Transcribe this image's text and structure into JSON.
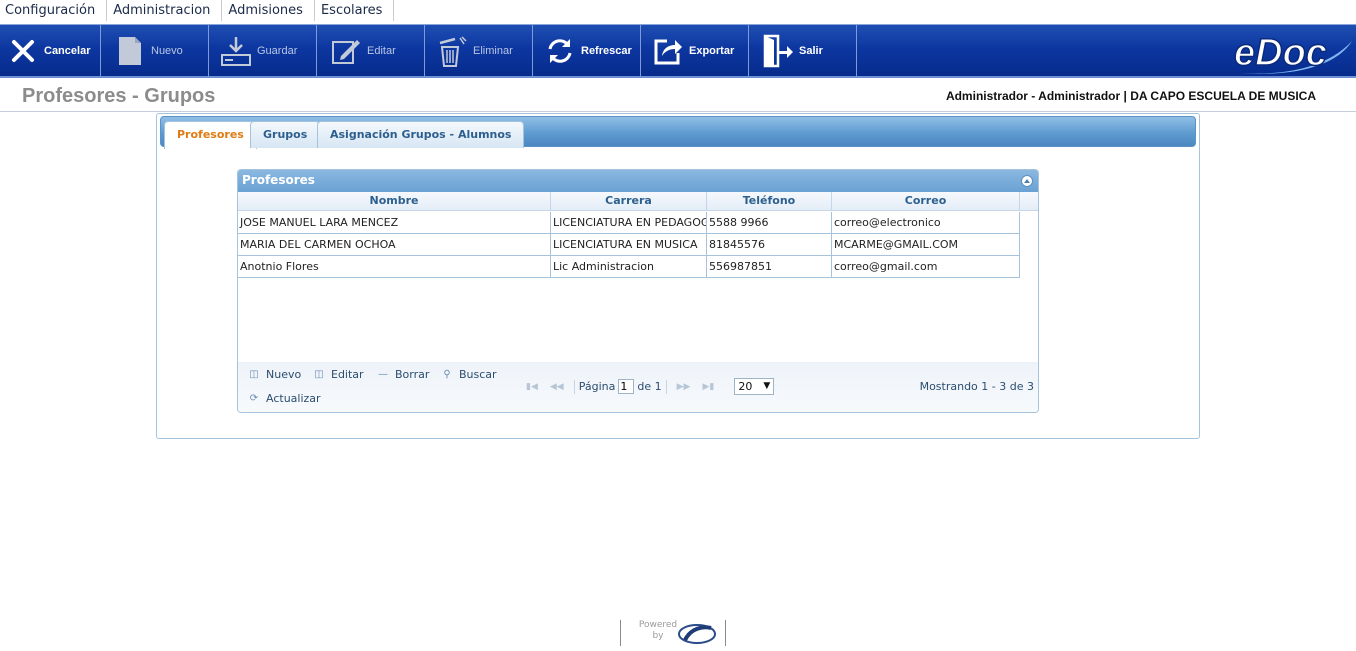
{
  "menu": [
    "Configuración",
    "Administracion",
    "Admisiones",
    "Escolares"
  ],
  "toolbar": {
    "cancel": "Cancelar",
    "new": "Nuevo",
    "save": "Guardar",
    "edit": "Editar",
    "delete": "Eliminar",
    "refresh": "Refrescar",
    "export": "Exportar",
    "exit": "Salir"
  },
  "logo": {
    "text": "eDoc"
  },
  "header": {
    "title": "Profesores - Grupos",
    "user_info": "Administrador - Administrador | DA CAPO ESCUELA DE MUSICA"
  },
  "tabs": [
    "Profesores",
    "Grupos",
    "Asignación Grupos - Alumnos"
  ],
  "grid": {
    "caption": "Profesores",
    "columns": [
      "Nombre",
      "Carrera",
      "Teléfono",
      "Correo"
    ],
    "rows": [
      [
        "JOSE MANUEL LARA MENCEZ",
        "LICENCIATURA EN PEDAGOGIA",
        "5588 9966",
        "correo@electronico"
      ],
      [
        "MARIA DEL CARMEN OCHOA",
        "LICENCIATURA EN MUSICA",
        "81845576",
        "MCARME@GMAIL.COM"
      ],
      [
        "Anotnio Flores",
        "Lic Administracion",
        "556987851",
        "correo@gmail.com"
      ]
    ]
  },
  "pager": {
    "new": "Nuevo",
    "edit": "Editar",
    "delete": "Borrar",
    "search": "Buscar",
    "refresh": "Actualizar",
    "page_label": "Página",
    "page_value": "1",
    "of_label": "de 1",
    "rows_per_page": "20",
    "range": "Mostrando 1 - 3 de 3"
  },
  "footer": {
    "powered_by": "Powered by"
  },
  "colors": {
    "toolbar": "#0d37a0",
    "accent_tab": "#e07b12",
    "grid_header": "#6aa2d4"
  }
}
